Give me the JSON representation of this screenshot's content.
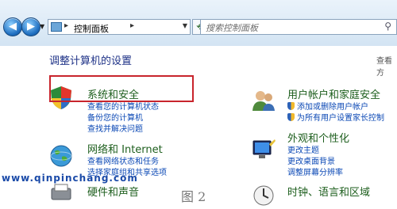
{
  "address_bar": {
    "crumb": "控制面板"
  },
  "search": {
    "placeholder": "搜索控制面板"
  },
  "page_title": "调整计算机的设置",
  "view_by": "查看方",
  "categories": [
    {
      "title": "系统和安全",
      "links": [
        "查看您的计算机状态",
        "备份您的计算机",
        "查找并解决问题"
      ]
    },
    {
      "title": "网络和 Internet",
      "links": [
        "查看网络状态和任务",
        "选择家庭组和共享选项"
      ]
    },
    {
      "title": "硬件和声音",
      "links": []
    },
    {
      "title": "用户帐户和家庭安全",
      "links": [
        "添加或删除用户帐户",
        "为所有用户设置家长控制"
      ]
    },
    {
      "title": "外观和个性化",
      "links": [
        "更改主题",
        "更改桌面背景",
        "调整屏幕分辨率"
      ]
    },
    {
      "title": "时钟、语言和区域",
      "links": []
    }
  ],
  "watermark": "www.qinpinchang.com",
  "figure_label": "图 2"
}
